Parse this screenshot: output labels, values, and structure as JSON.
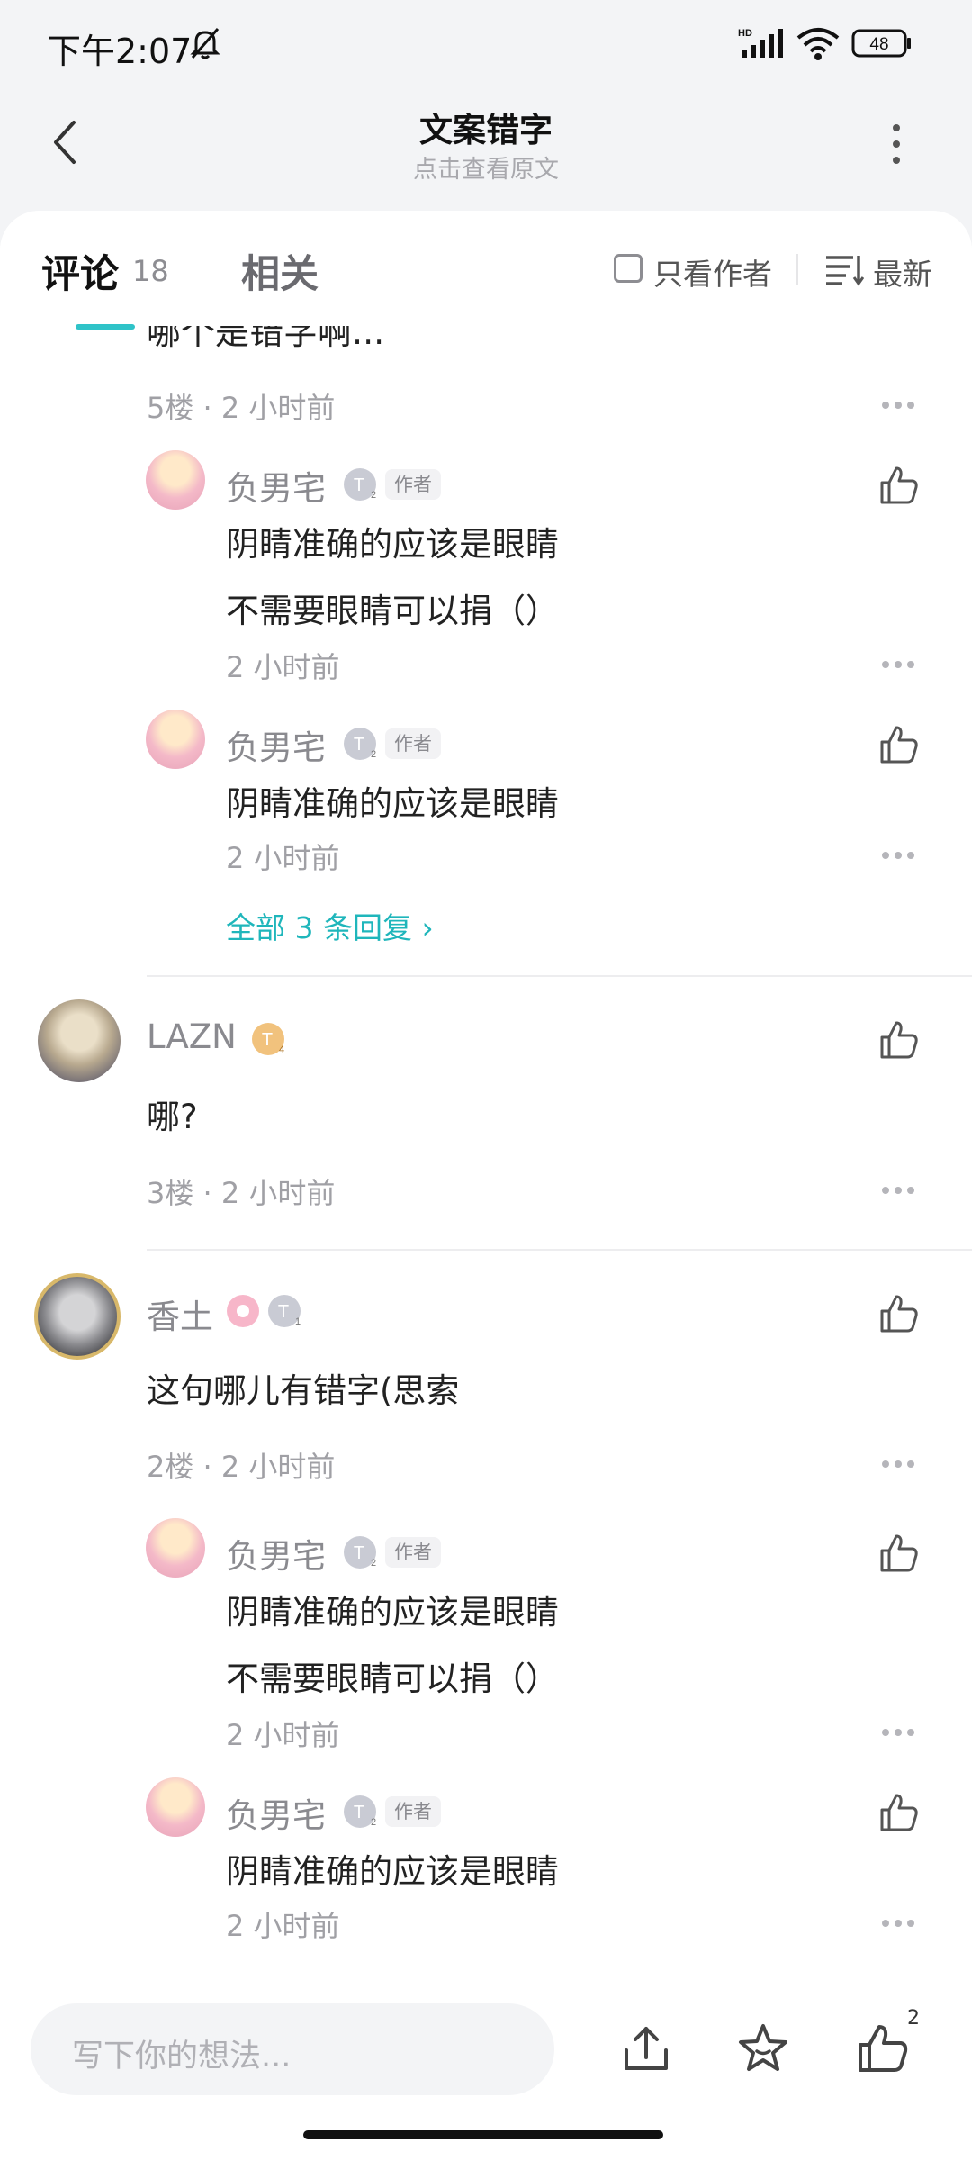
{
  "status": {
    "time": "下午2:07",
    "battery": "48",
    "network": "HD"
  },
  "header": {
    "title": "文案错字",
    "subtitle": "点击查看原文"
  },
  "tabs": {
    "comments_label": "评论",
    "comments_count": "18",
    "related_label": "相关",
    "only_author": "只看作者",
    "sort_label": "最新"
  },
  "feed": {
    "cut_text": "哪个是错字啊...",
    "floor5": {
      "meta": "5楼 · 2 小时前",
      "replies": [
        {
          "name": "负男宅",
          "level": "2",
          "tag": "作者",
          "lines": [
            "阴睛准确的应该是眼睛",
            "不需要眼睛可以捐（）"
          ],
          "time": "2 小时前"
        },
        {
          "name": "负男宅",
          "level": "2",
          "tag": "作者",
          "lines": [
            "阴睛准确的应该是眼睛"
          ],
          "time": "2 小时前"
        }
      ],
      "view_all": "全部 3 条回复 ›"
    },
    "floor3": {
      "name": "LAZN",
      "level": "4",
      "text": "哪?",
      "meta": "3楼 · 2 小时前"
    },
    "floor2": {
      "name": "香土",
      "level": "1",
      "text": "这句哪儿有错字(思索",
      "meta": "2楼 · 2 小时前",
      "replies": [
        {
          "name": "负男宅",
          "level": "2",
          "tag": "作者",
          "lines": [
            "阴睛准确的应该是眼睛",
            "不需要眼睛可以捐（）"
          ],
          "time": "2 小时前"
        },
        {
          "name": "负男宅",
          "level": "2",
          "tag": "作者",
          "lines": [
            "阴睛准确的应该是眼睛"
          ],
          "time": "2 小时前"
        }
      ]
    }
  },
  "bottom": {
    "placeholder": "写下你的想法...",
    "like_count": "2"
  },
  "icons": [
    "bell-off-icon",
    "signal-icon",
    "wifi-icon",
    "battery-icon",
    "back-arrow-icon",
    "more-vertical-icon",
    "sort-icon",
    "like-icon",
    "more-horizontal-icon",
    "share-icon",
    "star-icon",
    "level-badge-icon"
  ],
  "colors": {
    "accent": "#2fc3c8",
    "link": "#1fb6bb",
    "background": "#f3f4f6",
    "text": "#222222",
    "muted": "#a0a0a5"
  }
}
